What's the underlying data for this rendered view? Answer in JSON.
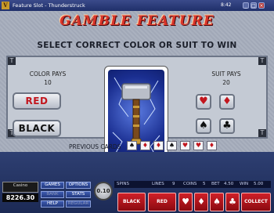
{
  "window": {
    "title": "Feature Slot - Thunderstruck",
    "time": "8:42",
    "controls": [
      "_",
      "□",
      "×"
    ]
  },
  "gamble": {
    "heading": "GAMBLE FEATURE",
    "instruction": "SELECT CORRECT COLOR OR SUIT TO WIN",
    "color_pays_label": "COLOR PAYS",
    "color_pays_value": "10",
    "suit_pays_label": "SUIT PAYS",
    "suit_pays_value": "20",
    "red_label": "RED",
    "black_label": "BLACK",
    "suits": [
      {
        "name": "hearts",
        "glyph": "♥",
        "color": "#c2161e"
      },
      {
        "name": "diamonds",
        "glyph": "♦",
        "color": "#c2161e"
      },
      {
        "name": "spades",
        "glyph": "♠",
        "color": "#111111"
      },
      {
        "name": "clubs",
        "glyph": "♣",
        "color": "#111111"
      }
    ],
    "previous_cards_label": "PREVIOUS CARDS",
    "previous_cards": [
      "♠",
      "♦",
      "♦",
      "♠",
      "♥",
      "♥",
      "♦"
    ]
  },
  "console": {
    "casino_logo": "Casino",
    "balance": "8226.30",
    "menu": {
      "games": "GAMES",
      "options": "OPTIONS",
      "bank": "BANK",
      "stats": "STATS",
      "help": "HELP",
      "regular": "REGULAR"
    },
    "coin_value": "0.10",
    "info": {
      "spins_label": "SPINS",
      "lines_label": "LINES",
      "lines_value": "9",
      "coins_label": "COINS",
      "coins_value": "5",
      "bet_label": "BET",
      "bet_value": "4.50",
      "win_label": "WIN",
      "win_value": "5.00"
    },
    "buttons": {
      "black": "BLACK",
      "red": "RED",
      "collect": "COLLECT"
    }
  },
  "colors": {
    "red": "#c2161e",
    "console_blue": "#2e3f72",
    "felt": "#a6adbb"
  }
}
